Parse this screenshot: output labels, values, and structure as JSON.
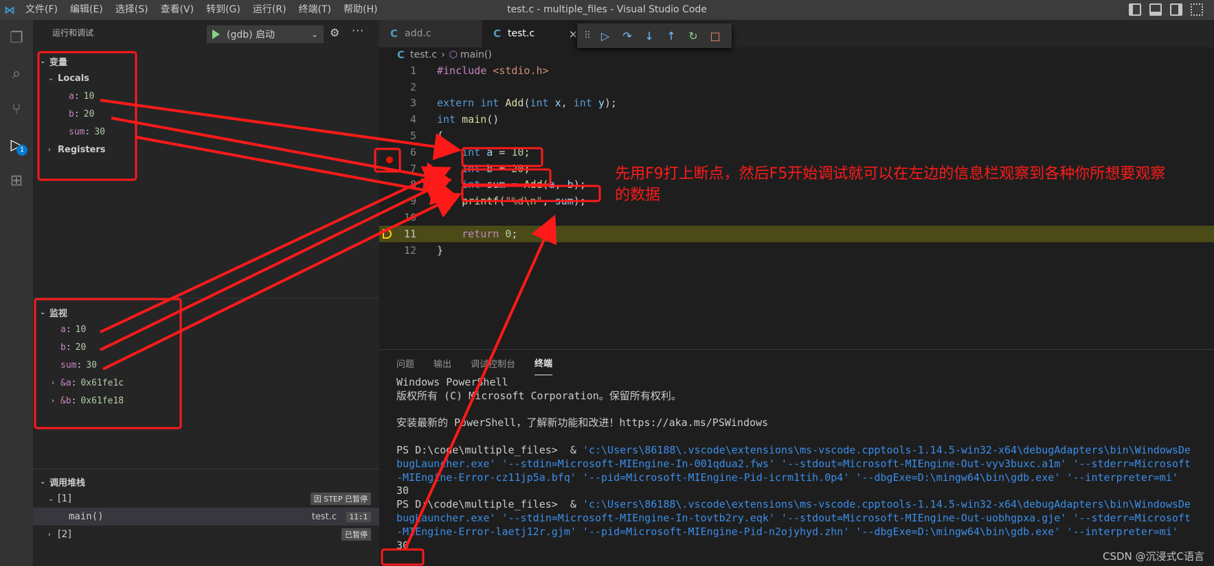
{
  "app": {
    "logo": "vscode-logo",
    "title": "test.c - multiple_files - Visual Studio Code",
    "menu": [
      "文件(F)",
      "编辑(E)",
      "选择(S)",
      "查看(V)",
      "转到(G)",
      "运行(R)",
      "终端(T)",
      "帮助(H)"
    ]
  },
  "activity": {
    "items": [
      "explorer-icon",
      "search-icon",
      "source-control-icon",
      "run-debug-icon",
      "extensions-icon"
    ],
    "debug_badge": "1"
  },
  "sidebar": {
    "header": "运行和调试",
    "config": "(gdb) 启动",
    "variables": {
      "title": "变量",
      "locals_label": "Locals",
      "locals": [
        {
          "name": "a",
          "value": "10"
        },
        {
          "name": "b",
          "value": "20"
        },
        {
          "name": "sum",
          "value": "30"
        }
      ],
      "registers_label": "Registers"
    },
    "watch": {
      "title": "监视",
      "items": [
        {
          "name": "a",
          "value": "10"
        },
        {
          "name": "b",
          "value": "20"
        },
        {
          "name": "sum",
          "value": "30"
        },
        {
          "name": "&a",
          "value": "0x61fe1c"
        },
        {
          "name": "&b",
          "value": "0x61fe18"
        }
      ]
    },
    "callstack": {
      "title": "调用堆栈",
      "threads": [
        {
          "label": "[1]",
          "status": "因 STEP 已暂停"
        },
        {
          "label": "[2]",
          "status": "已暂停"
        }
      ],
      "frame": {
        "name": "main()",
        "file": "test.c",
        "line": "11:1"
      }
    }
  },
  "editor": {
    "tabs": [
      {
        "label": "add.c",
        "active": false
      },
      {
        "label": "test.c",
        "active": true
      }
    ],
    "breadcrumb": {
      "file": "test.c",
      "symbol": "main()"
    },
    "current_line": 11,
    "breakpoint_line": 6
  },
  "annotation": {
    "text": "先用F9打上断点，然后F5开始调试就可以在左边的信息栏观察到各种你所想要观察的数据"
  },
  "panel": {
    "tabs": [
      "问题",
      "输出",
      "调试控制台",
      "终端"
    ],
    "active_tab": "终端",
    "terminal": {
      "l1": "Windows PowerShell",
      "l2": "版权所有 (C) Microsoft Corporation。保留所有权利。",
      "l3": "",
      "l4": "安装最新的 PowerShell，了解新功能和改进！https://aka.ms/PSWindows",
      "l5": "",
      "p1_prompt": "PS D:\\code\\multiple_files>  & ",
      "p1_path": "'c:\\Users\\86188\\.vscode\\extensions\\ms-vscode.cpptools-1.14.5-win32-x64\\debugAdapters\\bin\\WindowsDe",
      "p1_l2": "bugLauncher.exe' '--stdin=Microsoft-MIEngine-In-001qdua2.fws' '--stdout=Microsoft-MIEngine-Out-vyv3buxc.a1m' '--stderr=Microsoft",
      "p1_l3": "-MIEngine-Error-cz11jp5a.bfq' '--pid=Microsoft-MIEngine-Pid-icrm1tih.0p4' '--dbgExe=D:\\mingw64\\bin\\gdb.exe' '--interpreter=mi'",
      "out1": "30",
      "p2_prompt": "PS D:\\code\\multiple_files>  & ",
      "p2_path": "'c:\\Users\\86188\\.vscode\\extensions\\ms-vscode.cpptools-1.14.5-win32-x64\\debugAdapters\\bin\\WindowsDe",
      "p2_l2": "bugLauncher.exe' '--stdin=Microsoft-MIEngine-In-tovtb2ry.eqk' '--stdout=Microsoft-MIEngine-Out-uobhgpxa.gje' '--stderr=Microsoft",
      "p2_l3": "-MIEngine-Error-laetj12r.gjm' '--pid=Microsoft-MIEngine-Pid-n2ojyhyd.zhn' '--dbgExe=D:\\mingw64\\bin\\gdb.exe' '--interpreter=mi'",
      "out2": "30"
    },
    "watermark": "CSDN @沉浸式C语言"
  },
  "colors": {
    "annotation_red": "#ff1a1a",
    "accent": "#007acc",
    "current_line": "#4b4b18"
  }
}
